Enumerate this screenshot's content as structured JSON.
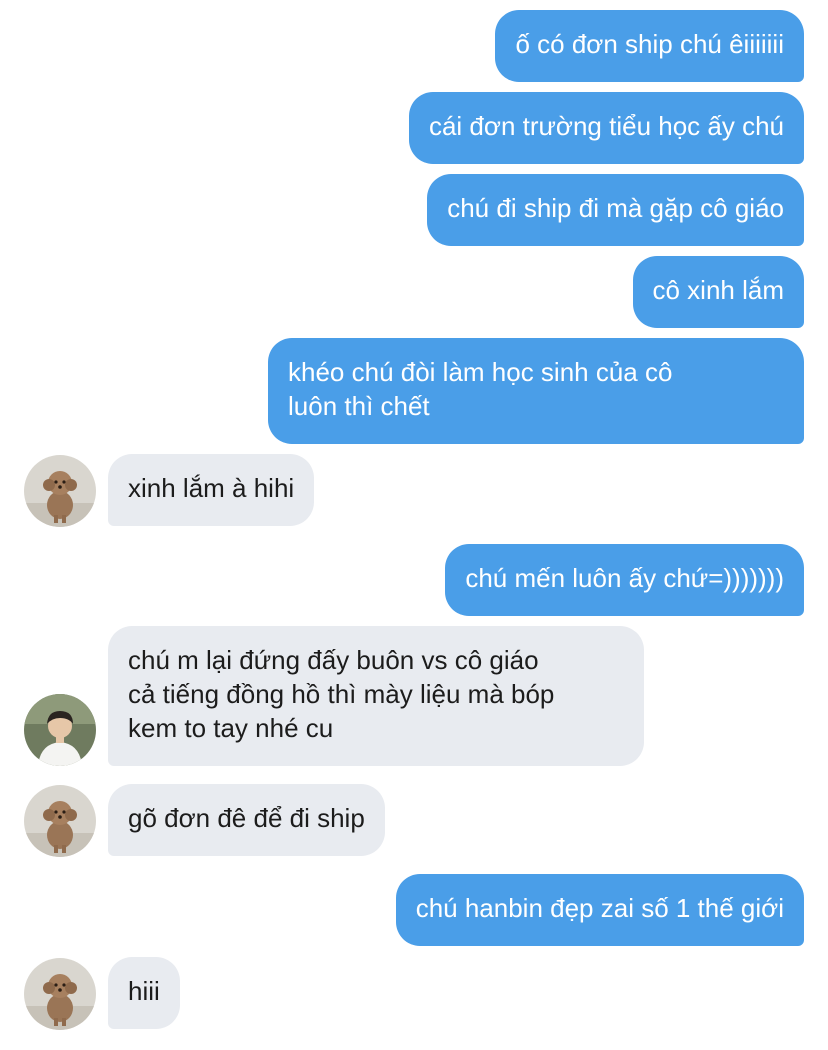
{
  "conversation": {
    "messages": [
      {
        "sender": "me",
        "text": "ố có đơn ship chú êiiiiiii"
      },
      {
        "sender": "me",
        "text": "cái đơn trường tiểu học ấy chú"
      },
      {
        "sender": "me",
        "text": "chú đi ship đi mà gặp cô giáo"
      },
      {
        "sender": "me",
        "text": "cô xinh lắm"
      },
      {
        "sender": "me",
        "text": "khéo chú đòi làm học sinh của cô\nluôn thì chết"
      },
      {
        "sender": "dog-avatar-user",
        "text": "xinh lắm à hihi"
      },
      {
        "sender": "me",
        "text": "chú mến luôn ấy chứ=)))))))"
      },
      {
        "sender": "boy-avatar-user",
        "text": "chú m lại đứng đấy buôn vs cô giáo\ncả tiếng đồng hồ thì mày liệu mà bóp\nkem to tay nhé cu"
      },
      {
        "sender": "dog-avatar-user",
        "text": "gõ đơn đê để đi ship"
      },
      {
        "sender": "me",
        "text": "chú hanbin đẹp zai số 1 thế giới"
      },
      {
        "sender": "dog-avatar-user",
        "text": "hiii"
      }
    ]
  },
  "colors": {
    "outgoing_bubble": "#4a9ee8",
    "incoming_bubble": "#e8ebf0",
    "outgoing_text": "#ffffff",
    "incoming_text": "#1c1c1c"
  },
  "icons": {
    "dog_avatar": "dog-avatar-icon",
    "boy_avatar": "boy-avatar-icon"
  }
}
